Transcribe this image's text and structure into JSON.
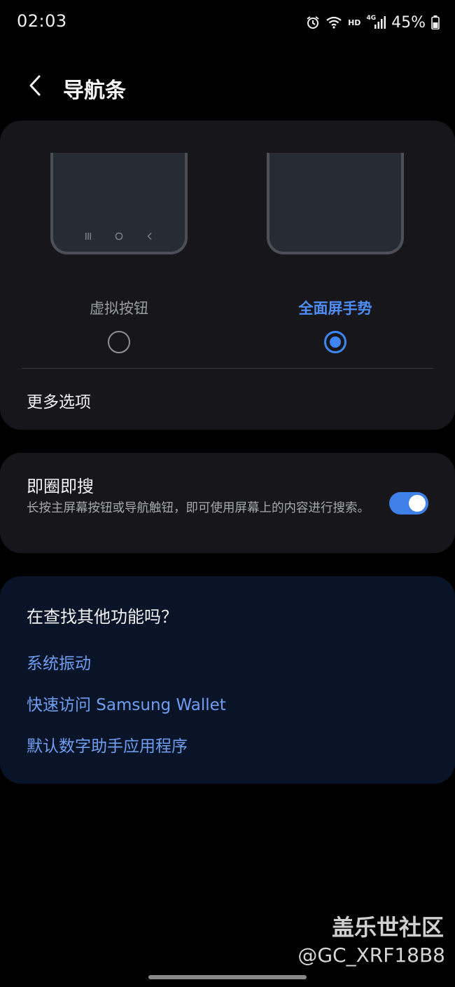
{
  "status_bar": {
    "time": "02:03",
    "hd": "HD",
    "network": "4G",
    "battery_percent": "45%",
    "icons": [
      "alarm-icon",
      "wifi-icon",
      "signal-icon",
      "battery-icon"
    ]
  },
  "header": {
    "back_icon": "chevron-left-icon",
    "title": "导航条"
  },
  "navigation_type": {
    "options": [
      {
        "label": "虚拟按钮",
        "selected": false
      },
      {
        "label": "全面屏手势",
        "selected": true
      }
    ],
    "more_options": "更多选项"
  },
  "circle_to_search": {
    "title": "即圈即搜",
    "description": "长按主屏幕按钮或导航触钮，即可使用屏幕上的内容进行搜索。",
    "enabled": true
  },
  "looking_for": {
    "title": "在查找其他功能吗？",
    "links": [
      "系统振动",
      "快速访问 Samsung Wallet",
      "默认数字助手应用程序"
    ]
  },
  "watermark": {
    "site": "盖乐世社区",
    "user": "@GC_XRF18B8"
  },
  "colors": {
    "accent": "#3f87f5",
    "link": "#6f9ef0",
    "card": "#17171b",
    "card_blue": "#0a1428",
    "background": "#000000"
  }
}
